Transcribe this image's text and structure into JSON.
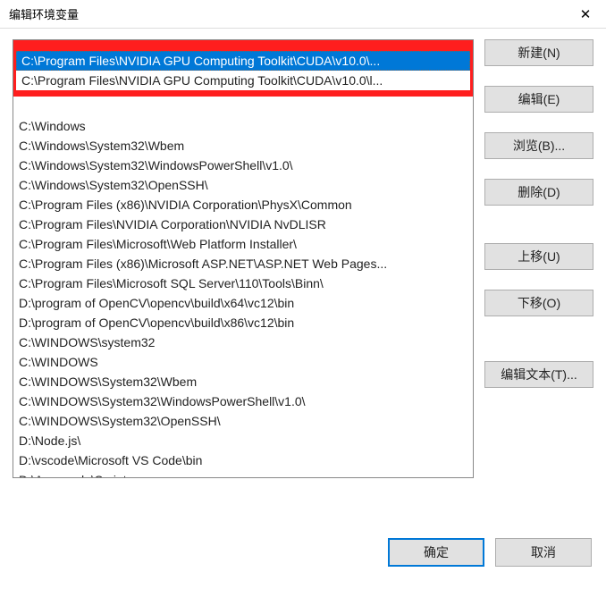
{
  "title": "编辑环境变量",
  "highlighted": [
    "C:\\Program Files\\NVIDIA GPU Computing Toolkit\\CUDA\\v10.0\\...",
    "C:\\Program Files\\NVIDIA GPU Computing Toolkit\\CUDA\\v10.0\\l..."
  ],
  "rows": [
    "",
    "C:\\Windows",
    "C:\\Windows\\System32\\Wbem",
    "C:\\Windows\\System32\\WindowsPowerShell\\v1.0\\",
    "C:\\Windows\\System32\\OpenSSH\\",
    "C:\\Program Files (x86)\\NVIDIA Corporation\\PhysX\\Common",
    "C:\\Program Files\\NVIDIA Corporation\\NVIDIA NvDLISR",
    "C:\\Program Files\\Microsoft\\Web Platform Installer\\",
    "C:\\Program Files (x86)\\Microsoft ASP.NET\\ASP.NET Web Pages...",
    "C:\\Program Files\\Microsoft SQL Server\\110\\Tools\\Binn\\",
    "D:\\program of OpenCV\\opencv\\build\\x64\\vc12\\bin",
    "D:\\program of OpenCV\\opencv\\build\\x86\\vc12\\bin",
    "C:\\WINDOWS\\system32",
    "C:\\WINDOWS",
    "C:\\WINDOWS\\System32\\Wbem",
    "C:\\WINDOWS\\System32\\WindowsPowerShell\\v1.0\\",
    "C:\\WINDOWS\\System32\\OpenSSH\\",
    "D:\\Node.js\\",
    "D:\\vscode\\Microsoft VS Code\\bin",
    "D:\\Anaconda\\Scripts"
  ],
  "buttons": {
    "new": "新建(N)",
    "edit": "编辑(E)",
    "browse": "浏览(B)...",
    "delete": "删除(D)",
    "moveUp": "上移(U)",
    "moveDown": "下移(O)",
    "editText": "编辑文本(T)...",
    "ok": "确定",
    "cancel": "取消"
  }
}
